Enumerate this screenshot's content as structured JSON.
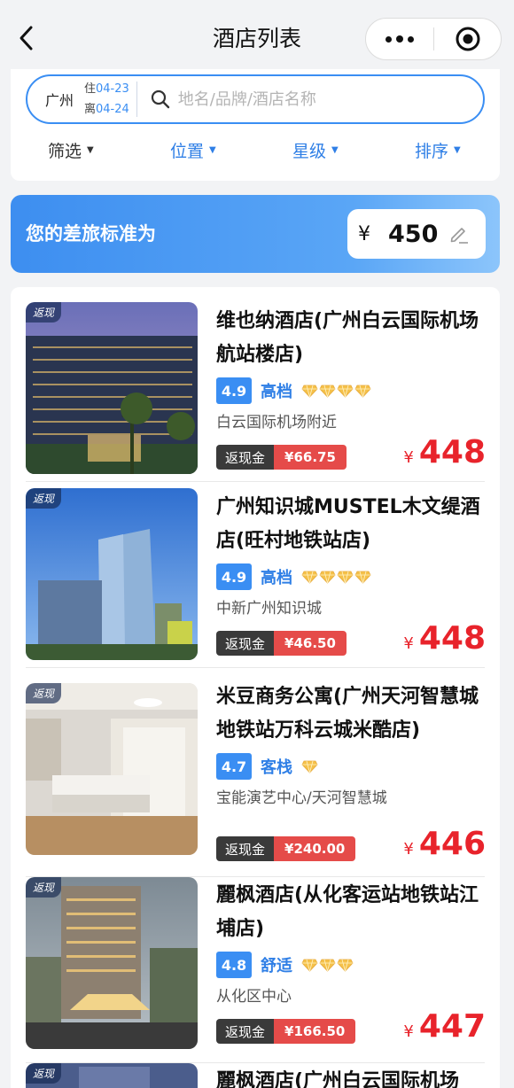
{
  "header": {
    "title": "酒店列表",
    "back_icon": "chevron-left-icon",
    "more_icon": "more-dots-icon",
    "close_icon": "target-close-icon"
  },
  "search": {
    "city": "广州",
    "checkin_label": "住",
    "checkin_date": "04-23",
    "checkout_label": "离",
    "checkout_date": "04-24",
    "placeholder": "地名/品牌/酒店名称"
  },
  "filters": [
    {
      "label": "筛选"
    },
    {
      "label": "位置"
    },
    {
      "label": "星级"
    },
    {
      "label": "排序"
    }
  ],
  "standard": {
    "label": "您的差旅标准为",
    "currency": "¥",
    "amount": "450"
  },
  "hotels": [
    {
      "tag": "返现",
      "name": "维也纳酒店(广州白云国际机场航站楼店)",
      "score": "4.9",
      "grade": "高档",
      "diamonds": 4,
      "location": "白云国际机场附近",
      "cashback_label": "返现金",
      "cashback_value": "¥66.75",
      "price_symbol": "¥",
      "price": "448"
    },
    {
      "tag": "返现",
      "name": "广州知识城MUSTEL木文缇酒店(旺村地铁站店)",
      "score": "4.9",
      "grade": "高档",
      "diamonds": 4,
      "location": "中新广州知识城",
      "cashback_label": "返现金",
      "cashback_value": "¥46.50",
      "price_symbol": "¥",
      "price": "448"
    },
    {
      "tag": "返现",
      "name": "米豆商务公寓(广州天河智慧城地铁站万科云城米酷店)",
      "score": "4.7",
      "grade": "客栈",
      "diamonds": 1,
      "location": "宝能演艺中心/天河智慧城",
      "cashback_label": "返现金",
      "cashback_value": "¥240.00",
      "price_symbol": "¥",
      "price": "446"
    },
    {
      "tag": "返现",
      "name": "麗枫酒店(从化客运站地铁站江埔店)",
      "score": "4.8",
      "grade": "舒适",
      "diamonds": 3,
      "location": "从化区中心",
      "cashback_label": "返现金",
      "cashback_value": "¥166.50",
      "price_symbol": "¥",
      "price": "447"
    },
    {
      "tag": "返现",
      "name": "麗枫酒店(广州白云国际机场",
      "score": "",
      "grade": "",
      "diamonds": 0,
      "location": "",
      "cashback_label": "",
      "cashback_value": "",
      "price_symbol": "",
      "price": ""
    }
  ],
  "colors": {
    "accent": "#3a8ef3",
    "price_red": "#e8232b",
    "cash_red": "#e54b49",
    "diamond_gold": "#f5c14a"
  }
}
